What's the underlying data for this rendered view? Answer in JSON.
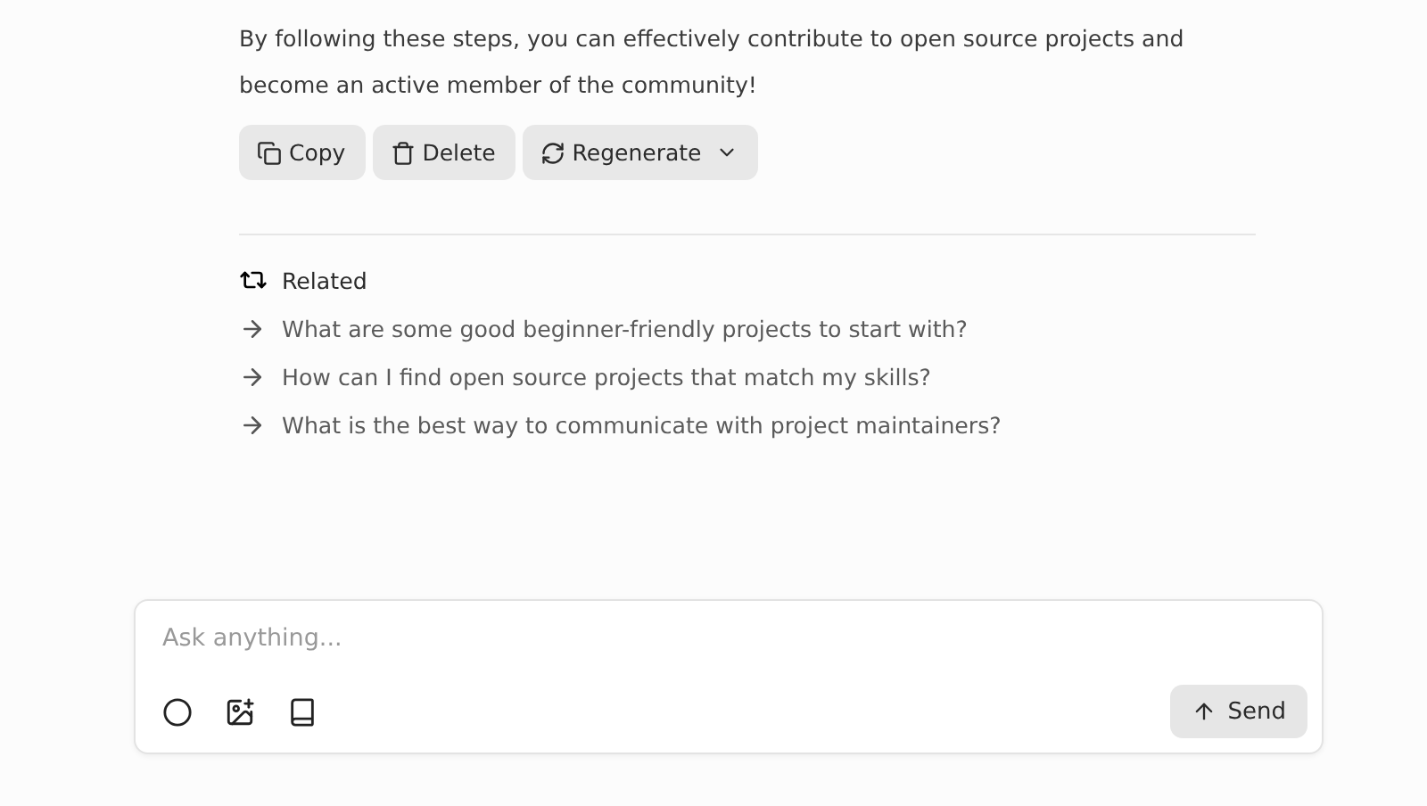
{
  "answer": {
    "paragraph": "By following these steps, you can effectively contribute to open source projects and become an active member of the community!"
  },
  "actions": [
    {
      "kind": "copy",
      "label": "Copy",
      "dropdown": false
    },
    {
      "kind": "delete",
      "label": "Delete",
      "dropdown": false
    },
    {
      "kind": "regenerate",
      "label": "Regenerate",
      "dropdown": true
    }
  ],
  "related": {
    "title": "Related",
    "items": [
      "What are some good beginner-friendly projects to start with?",
      "How can I find open source projects that match my skills?",
      "What is the best way to communicate with project maintainers?"
    ]
  },
  "composer": {
    "placeholder": "Ask anything...",
    "tools": [
      {
        "kind": "circle"
      },
      {
        "kind": "image"
      },
      {
        "kind": "book"
      }
    ],
    "send": "Send"
  }
}
